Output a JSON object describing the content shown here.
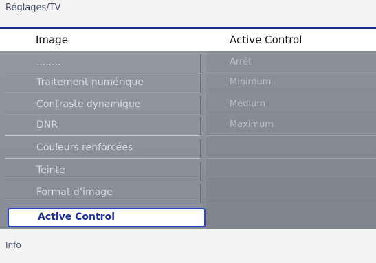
{
  "breadcrumb": "Réglages/TV",
  "header": {
    "left_title": "Image",
    "right_title": "Active Control"
  },
  "menu": {
    "items": [
      {
        "label": "........"
      },
      {
        "label": "Traitement numérique"
      },
      {
        "label": "Contraste dynamique"
      },
      {
        "label": "DNR"
      },
      {
        "label": "Couleurs renforcées"
      },
      {
        "label": "Teinte"
      },
      {
        "label": "Format d’image"
      },
      {
        "label": "Active Control"
      }
    ],
    "selected_index": 7
  },
  "options": {
    "items": [
      {
        "label": "Arrêt"
      },
      {
        "label": "Minimum"
      },
      {
        "label": "Medium"
      },
      {
        "label": "Maximum"
      }
    ]
  },
  "footer": {
    "label": "Info"
  },
  "colors": {
    "accent": "#2b44c8",
    "selected_text": "#1b2f8f",
    "panel_bg": "#8b8f97"
  }
}
